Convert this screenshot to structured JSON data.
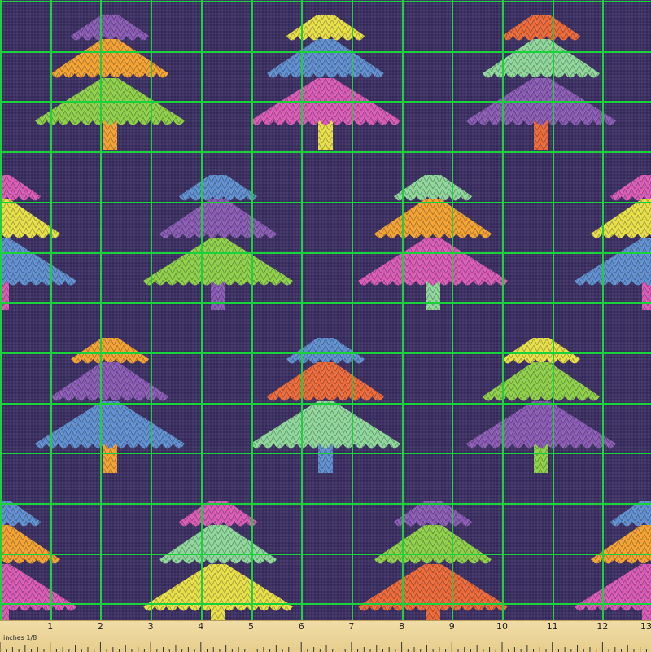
{
  "fabric": {
    "background": "#3a2e62",
    "grid_color": "#19d23c",
    "grid_cells": 13,
    "trees": [
      {
        "tiers": [
          "#8a5bb5",
          "#f4a332",
          "#8fd04a"
        ],
        "trunk": "#f4a332"
      },
      {
        "tiers": [
          "#e8e048",
          "#5f8fd0",
          "#d95bb6"
        ],
        "trunk": "#e8e048"
      },
      {
        "tiers": [
          "#ec6a3a",
          "#8fd79b",
          "#8a5bb5"
        ],
        "trunk": "#ec6a3a"
      },
      {
        "tiers": [
          "#5f8fd0",
          "#8a5bb5",
          "#8fd04a"
        ],
        "trunk": "#8a5bb5"
      },
      {
        "tiers": [
          "#8fd79b",
          "#f4a332",
          "#d95bb6"
        ],
        "trunk": "#8fd79b"
      },
      {
        "tiers": [
          "#f4a332",
          "#8a5bb5",
          "#5f8fd0"
        ],
        "trunk": "#f4a332"
      },
      {
        "tiers": [
          "#5f8fd0",
          "#ec6a3a",
          "#8fd79b"
        ],
        "trunk": "#5f8fd0"
      },
      {
        "tiers": [
          "#e8e048",
          "#8fd04a",
          "#8a5bb5"
        ],
        "trunk": "#8fd04a"
      },
      {
        "tiers": [
          "#d95bb6",
          "#8fd79b",
          "#e8e048"
        ],
        "trunk": "#e8e048"
      },
      {
        "tiers": [
          "#8a5bb5",
          "#8fd04a",
          "#ec6a3a"
        ],
        "trunk": "#ec6a3a"
      },
      {
        "tiers": [
          "#d95bb6",
          "#e8e048",
          "#5f8fd0"
        ],
        "trunk": "#d95bb6"
      },
      {
        "tiers": [
          "#d95bb6",
          "#e8e048",
          "#5f8fd0"
        ],
        "trunk": "#d95bb6"
      },
      {
        "tiers": [
          "#5f8fd0",
          "#f4a332",
          "#d95bb6"
        ],
        "trunk": "#d95bb6"
      },
      {
        "tiers": [
          "#5f8fd0",
          "#f4a332",
          "#d95bb6"
        ],
        "trunk": "#d95bb6"
      }
    ]
  },
  "ruler": {
    "caption": "inches 1/8",
    "labels": [
      "1",
      "2",
      "3",
      "4",
      "5",
      "6",
      "7",
      "8",
      "9",
      "10",
      "11",
      "12",
      "13"
    ]
  }
}
